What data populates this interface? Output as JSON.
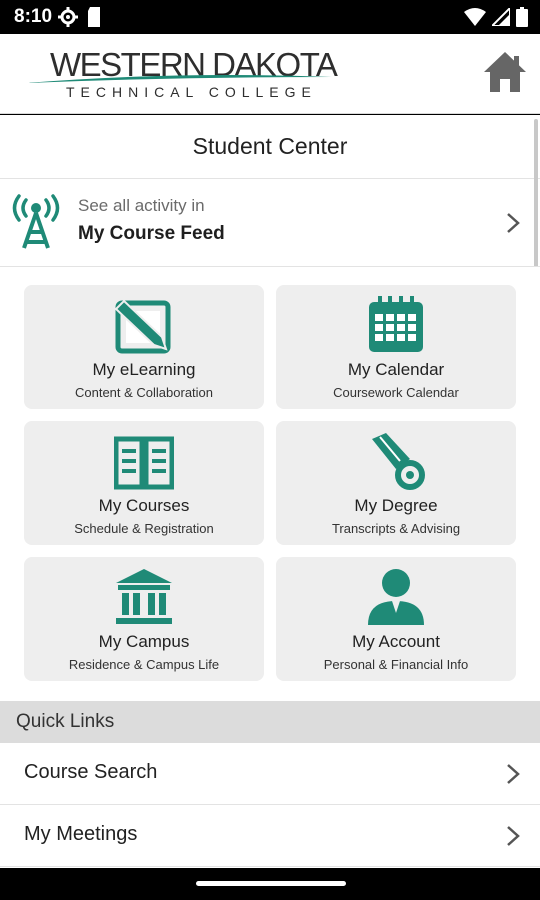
{
  "status_bar": {
    "time": "8:10",
    "icons": [
      "settings-icon",
      "sim-card-icon",
      "wifi-icon",
      "signal-icon",
      "battery-icon"
    ]
  },
  "header": {
    "logo": {
      "title": "WESTERN DAKOTA",
      "subtitle": "TECHNICAL COLLEGE"
    },
    "home_icon": "home-icon"
  },
  "page": {
    "title": "Student Center"
  },
  "course_feed": {
    "subtitle": "See all activity in",
    "title": "My Course Feed",
    "icon": "antenna-icon"
  },
  "tiles": [
    {
      "title": "My eLearning",
      "subtitle": "Content & Collaboration",
      "icon": "pencil-edit-icon"
    },
    {
      "title": "My Calendar",
      "subtitle": "Coursework Calendar",
      "icon": "calendar-icon"
    },
    {
      "title": "My Courses",
      "subtitle": "Schedule & Registration",
      "icon": "open-book-icon"
    },
    {
      "title": "My Degree",
      "subtitle": "Transcripts & Advising",
      "icon": "diploma-icon"
    },
    {
      "title": "My Campus",
      "subtitle": "Residence & Campus Life",
      "icon": "building-columns-icon"
    },
    {
      "title": "My Account",
      "subtitle": "Personal & Financial Info",
      "icon": "person-icon"
    }
  ],
  "quick_links": {
    "header": "Quick Links",
    "items": [
      {
        "label": "Course Search"
      },
      {
        "label": "My Meetings"
      }
    ]
  },
  "colors": {
    "accent": "#1f8a77",
    "tile_bg": "#eeeeee",
    "home_icon": "#666666"
  }
}
